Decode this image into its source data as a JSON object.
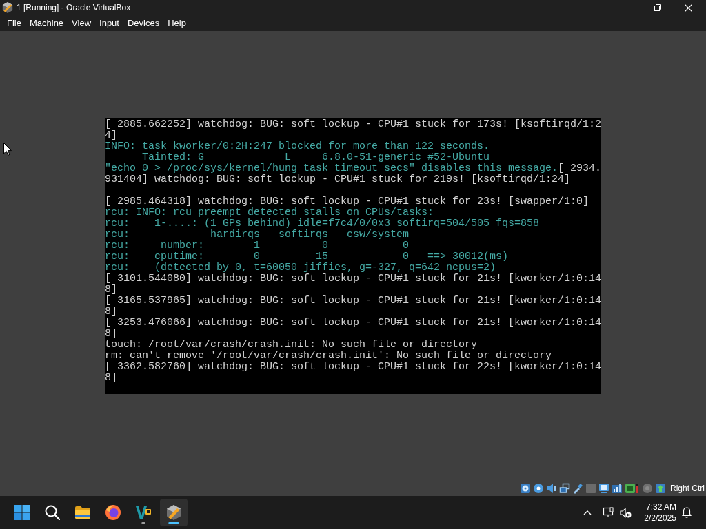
{
  "window": {
    "title": "1 [Running] - Oracle VirtualBox"
  },
  "menu_bar": [
    "File",
    "Machine",
    "View",
    "Input",
    "Devices",
    "Help"
  ],
  "console": {
    "lines": [
      {
        "kind": "text",
        "segments": [
          {
            "kind": "plain",
            "text": "[ 2885.662252] watchdog: BUG: soft lockup - CPU#1 stuck for 173s! [ksoftirqd/1:2"
          }
        ]
      },
      {
        "kind": "text",
        "segments": [
          {
            "kind": "plain",
            "text": "4]"
          }
        ]
      },
      {
        "kind": "text",
        "segments": [
          {
            "kind": "info",
            "text": "INFO: task kworker/0:2H:247 blocked for more than 122 seconds."
          }
        ]
      },
      {
        "kind": "text",
        "segments": [
          {
            "kind": "info",
            "text": "      Tainted: G             L     6.8.0-51-generic #52-Ubuntu"
          }
        ]
      },
      {
        "kind": "text",
        "segments": [
          {
            "kind": "info",
            "text": "\"echo 0 > /proc/sys/kernel/hung_task_timeout_secs\" disables this message."
          },
          {
            "kind": "plain",
            "text": "[ 2934."
          }
        ]
      },
      {
        "kind": "text",
        "segments": [
          {
            "kind": "plain",
            "text": "931404] watchdog: BUG: soft lockup - CPU#1 stuck for 219s! [ksoftirqd/1:24]"
          }
        ]
      },
      {
        "kind": "blank"
      },
      {
        "kind": "text",
        "segments": [
          {
            "kind": "plain",
            "text": "[ 2985.464318] watchdog: BUG: soft lockup - CPU#1 stuck for 23s! [swapper/1:0]"
          }
        ]
      },
      {
        "kind": "text",
        "segments": [
          {
            "kind": "info",
            "text": "rcu: INFO: rcu_preempt detected stalls on CPUs/tasks:"
          }
        ]
      },
      {
        "kind": "text",
        "segments": [
          {
            "kind": "info",
            "text": "rcu:    1-....: (1 GPs behind) idle=f7c4/0/0x3 softirq=504/505 fqs=858"
          }
        ]
      },
      {
        "kind": "text",
        "segments": [
          {
            "kind": "info",
            "text": "rcu:             hardirqs   softirqs   csw/system"
          }
        ]
      },
      {
        "kind": "text",
        "segments": [
          {
            "kind": "info",
            "text": "rcu:     number:        1          0            0"
          }
        ]
      },
      {
        "kind": "text",
        "segments": [
          {
            "kind": "info",
            "text": "rcu:    cputime:        0         15            0   ==> 30012(ms)"
          }
        ]
      },
      {
        "kind": "text",
        "segments": [
          {
            "kind": "info",
            "text": "rcu:    (detected by 0, t=60050 jiffies, g=-327, q=642 ncpus=2)"
          }
        ]
      },
      {
        "kind": "text",
        "segments": [
          {
            "kind": "plain",
            "text": "[ 3101.544080] watchdog: BUG: soft lockup - CPU#1 stuck for 21s! [kworker/1:0:14"
          }
        ]
      },
      {
        "kind": "text",
        "segments": [
          {
            "kind": "plain",
            "text": "8]"
          }
        ]
      },
      {
        "kind": "text",
        "segments": [
          {
            "kind": "plain",
            "text": "[ 3165.537965] watchdog: BUG: soft lockup - CPU#1 stuck for 21s! [kworker/1:0:14"
          }
        ]
      },
      {
        "kind": "text",
        "segments": [
          {
            "kind": "plain",
            "text": "8]"
          }
        ]
      },
      {
        "kind": "text",
        "segments": [
          {
            "kind": "plain",
            "text": "[ 3253.476066] watchdog: BUG: soft lockup - CPU#1 stuck for 21s! [kworker/1:0:14"
          }
        ]
      },
      {
        "kind": "text",
        "segments": [
          {
            "kind": "plain",
            "text": "8]"
          }
        ]
      },
      {
        "kind": "text",
        "segments": [
          {
            "kind": "plain",
            "text": "touch: /root/var/crash/crash.init: No such file or directory"
          }
        ]
      },
      {
        "kind": "text",
        "segments": [
          {
            "kind": "plain",
            "text": "rm: can't remove '/root/var/crash/crash.init': No such file or directory"
          }
        ]
      },
      {
        "kind": "text",
        "segments": [
          {
            "kind": "plain",
            "text": "[ 3362.582760] watchdog: BUG: soft lockup - CPU#1 stuck for 22s! [kworker/1:0:14"
          }
        ]
      },
      {
        "kind": "text",
        "segments": [
          {
            "kind": "plain",
            "text": "8]"
          }
        ]
      }
    ]
  },
  "status_bar": {
    "host_key": "Right Ctrl"
  },
  "taskbar": {
    "apps": [
      {
        "kind": "folder",
        "running": false,
        "selected": false
      },
      {
        "kind": "globe",
        "running": false,
        "selected": false
      },
      {
        "kind": "code",
        "running": true,
        "selected": false
      },
      {
        "kind": "cube",
        "running": true,
        "selected": true
      }
    ],
    "clock": {
      "time": "7:32 AM",
      "date": "2/2/2025"
    }
  }
}
